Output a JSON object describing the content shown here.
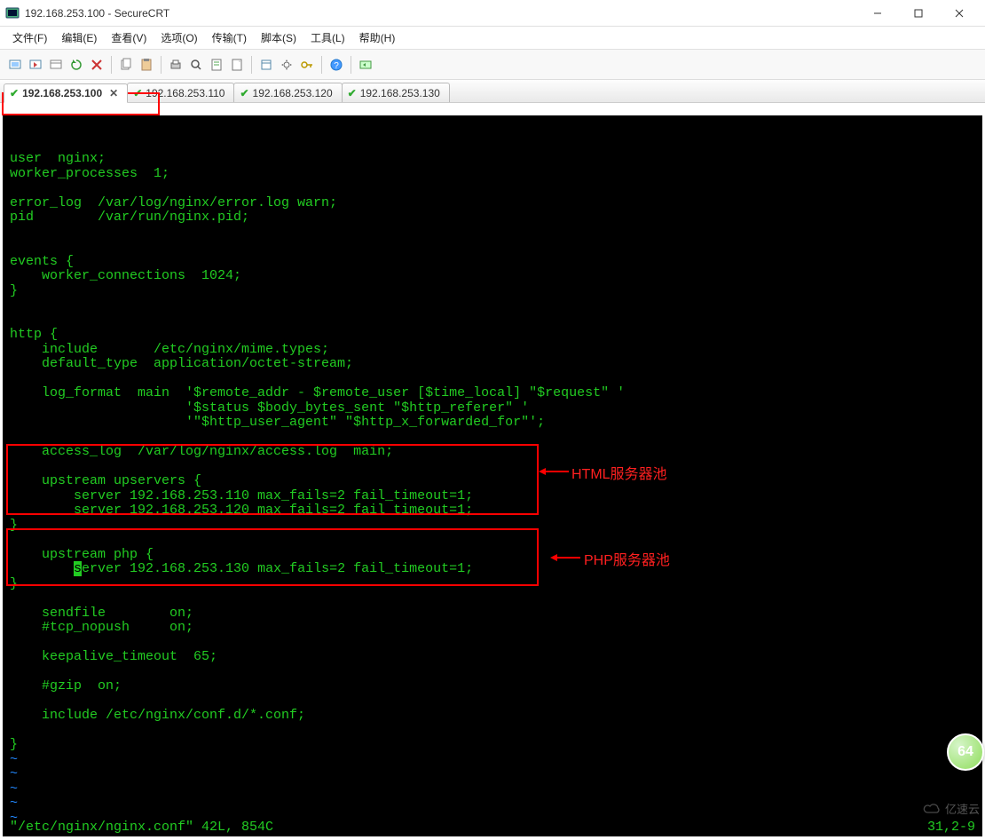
{
  "window": {
    "title": "192.168.253.100 - SecureCRT"
  },
  "menu": {
    "file": "文件(F)",
    "edit": "编辑(E)",
    "view": "查看(V)",
    "options": "选项(O)",
    "transfer": "传输(T)",
    "script": "脚本(S)",
    "tools": "工具(L)",
    "help": "帮助(H)"
  },
  "tabs": [
    {
      "label": "192.168.253.100",
      "active": true,
      "closable": true
    },
    {
      "label": "192.168.253.110",
      "active": false,
      "closable": false
    },
    {
      "label": "192.168.253.120",
      "active": false,
      "closable": false
    },
    {
      "label": "192.168.253.130",
      "active": false,
      "closable": false
    }
  ],
  "terminal": {
    "lines": [
      "user  nginx;",
      "worker_processes  1;",
      "",
      "error_log  /var/log/nginx/error.log warn;",
      "pid        /var/run/nginx.pid;",
      "",
      "",
      "events {",
      "    worker_connections  1024;",
      "}",
      "",
      "",
      "http {",
      "    include       /etc/nginx/mime.types;",
      "    default_type  application/octet-stream;",
      "",
      "    log_format  main  '$remote_addr - $remote_user [$time_local] \"$request\" '",
      "                      '$status $body_bytes_sent \"$http_referer\" '",
      "                      '\"$http_user_agent\" \"$http_x_forwarded_for\"';",
      "",
      "    access_log  /var/log/nginx/access.log  main;",
      "",
      "    upstream upservers {",
      "        server 192.168.253.110 max_fails=2 fail_timeout=1;",
      "        server 192.168.253.120 max_fails=2 fail_timeout=1;",
      "}",
      "",
      "    upstream php {",
      "        server 192.168.253.130 max_fails=2 fail_timeout=1;",
      "}",
      "",
      "    sendfile        on;",
      "    #tcp_nopush     on;",
      "",
      "    keepalive_timeout  65;",
      "",
      "    #gzip  on;",
      "",
      "    include /etc/nginx/conf.d/*.conf;",
      "",
      "}"
    ],
    "tilde": "~",
    "cursor_line_index": 28,
    "cursor_col": 8,
    "status_left": "\"/etc/nginx/nginx.conf\" 42L, 854C",
    "status_right": "31,2-9"
  },
  "annotations": {
    "html_pool": "HTML服务器池",
    "php_pool": "PHP服务器池"
  },
  "watermark": "亿速云",
  "badge": "64"
}
